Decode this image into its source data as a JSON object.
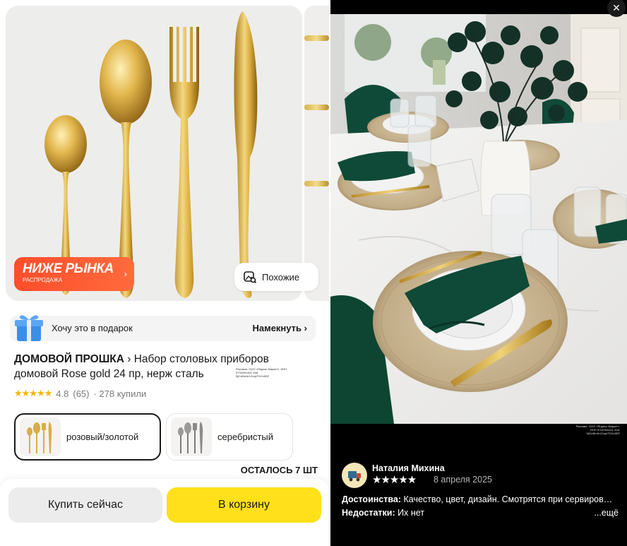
{
  "product_card": {
    "market_badge": {
      "text": "НИЖЕ РЫНКА",
      "subtext": "РАСПРОДАЖА"
    },
    "similar_label": "Похожие",
    "gift": {
      "text": "Хочу это в подарок",
      "action": "Намекнуть"
    },
    "brand": "ДОМОВОЙ ПРОШКА",
    "product_title": "Набор столовых приборов домовой Rose gold 24 пр, нерж сталь",
    "ad_disclaimer": "Реклама. ООО «Яндекс Маркет», ИНН 9704254424, erid: 5jiCeBe4e1ZoqkTDXn5DF",
    "rating": {
      "stars": "★★★★★",
      "value": "4.8",
      "reviews": "(65)",
      "sold": "· 278 купили"
    },
    "variants": [
      {
        "label": "розовый/золотой",
        "selected": true
      },
      {
        "label": "серебристый",
        "selected": false
      }
    ],
    "stock": "ОСТАЛОСЬ 7 ШТ",
    "buy_now": "Купить сейчас",
    "add_to_cart": "В корзину",
    "colors": {
      "accent_yellow": "#ffe01b",
      "badge_red": "#ff4d2a",
      "star": "#f5b400"
    }
  },
  "review_panel": {
    "close_icon": "close-icon",
    "ad_disclaimer": "Реклама. ООО «Яндекс Маркет», ИНН 9704254424, erid: 5jiCeBe4e1ZoqkTDXn5DF",
    "reviewer": "Наталия Михина",
    "stars": "★★★★★",
    "date": "8 апреля 2025",
    "pros_label": "Достоинства:",
    "pros_text": "Качество, цвет, дизайн. Смотрятся при сервиров…",
    "cons_label": "Недостатки:",
    "cons_text": "Их нет",
    "more": "...ещё"
  }
}
